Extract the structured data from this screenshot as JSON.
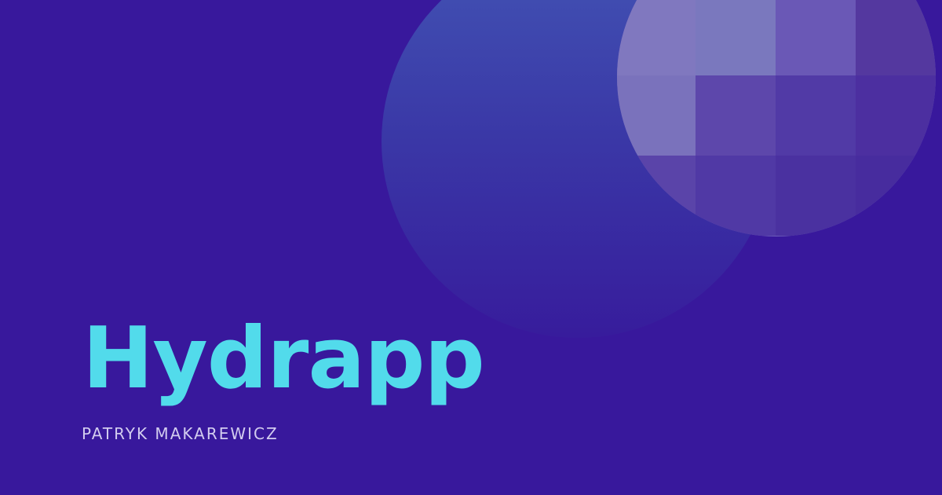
{
  "title": "Hydrapp",
  "author": "PATRYK MAKAREWICZ",
  "colors": {
    "background": "#38189c",
    "title": "#52dbeb",
    "author": "#d2ccef"
  }
}
